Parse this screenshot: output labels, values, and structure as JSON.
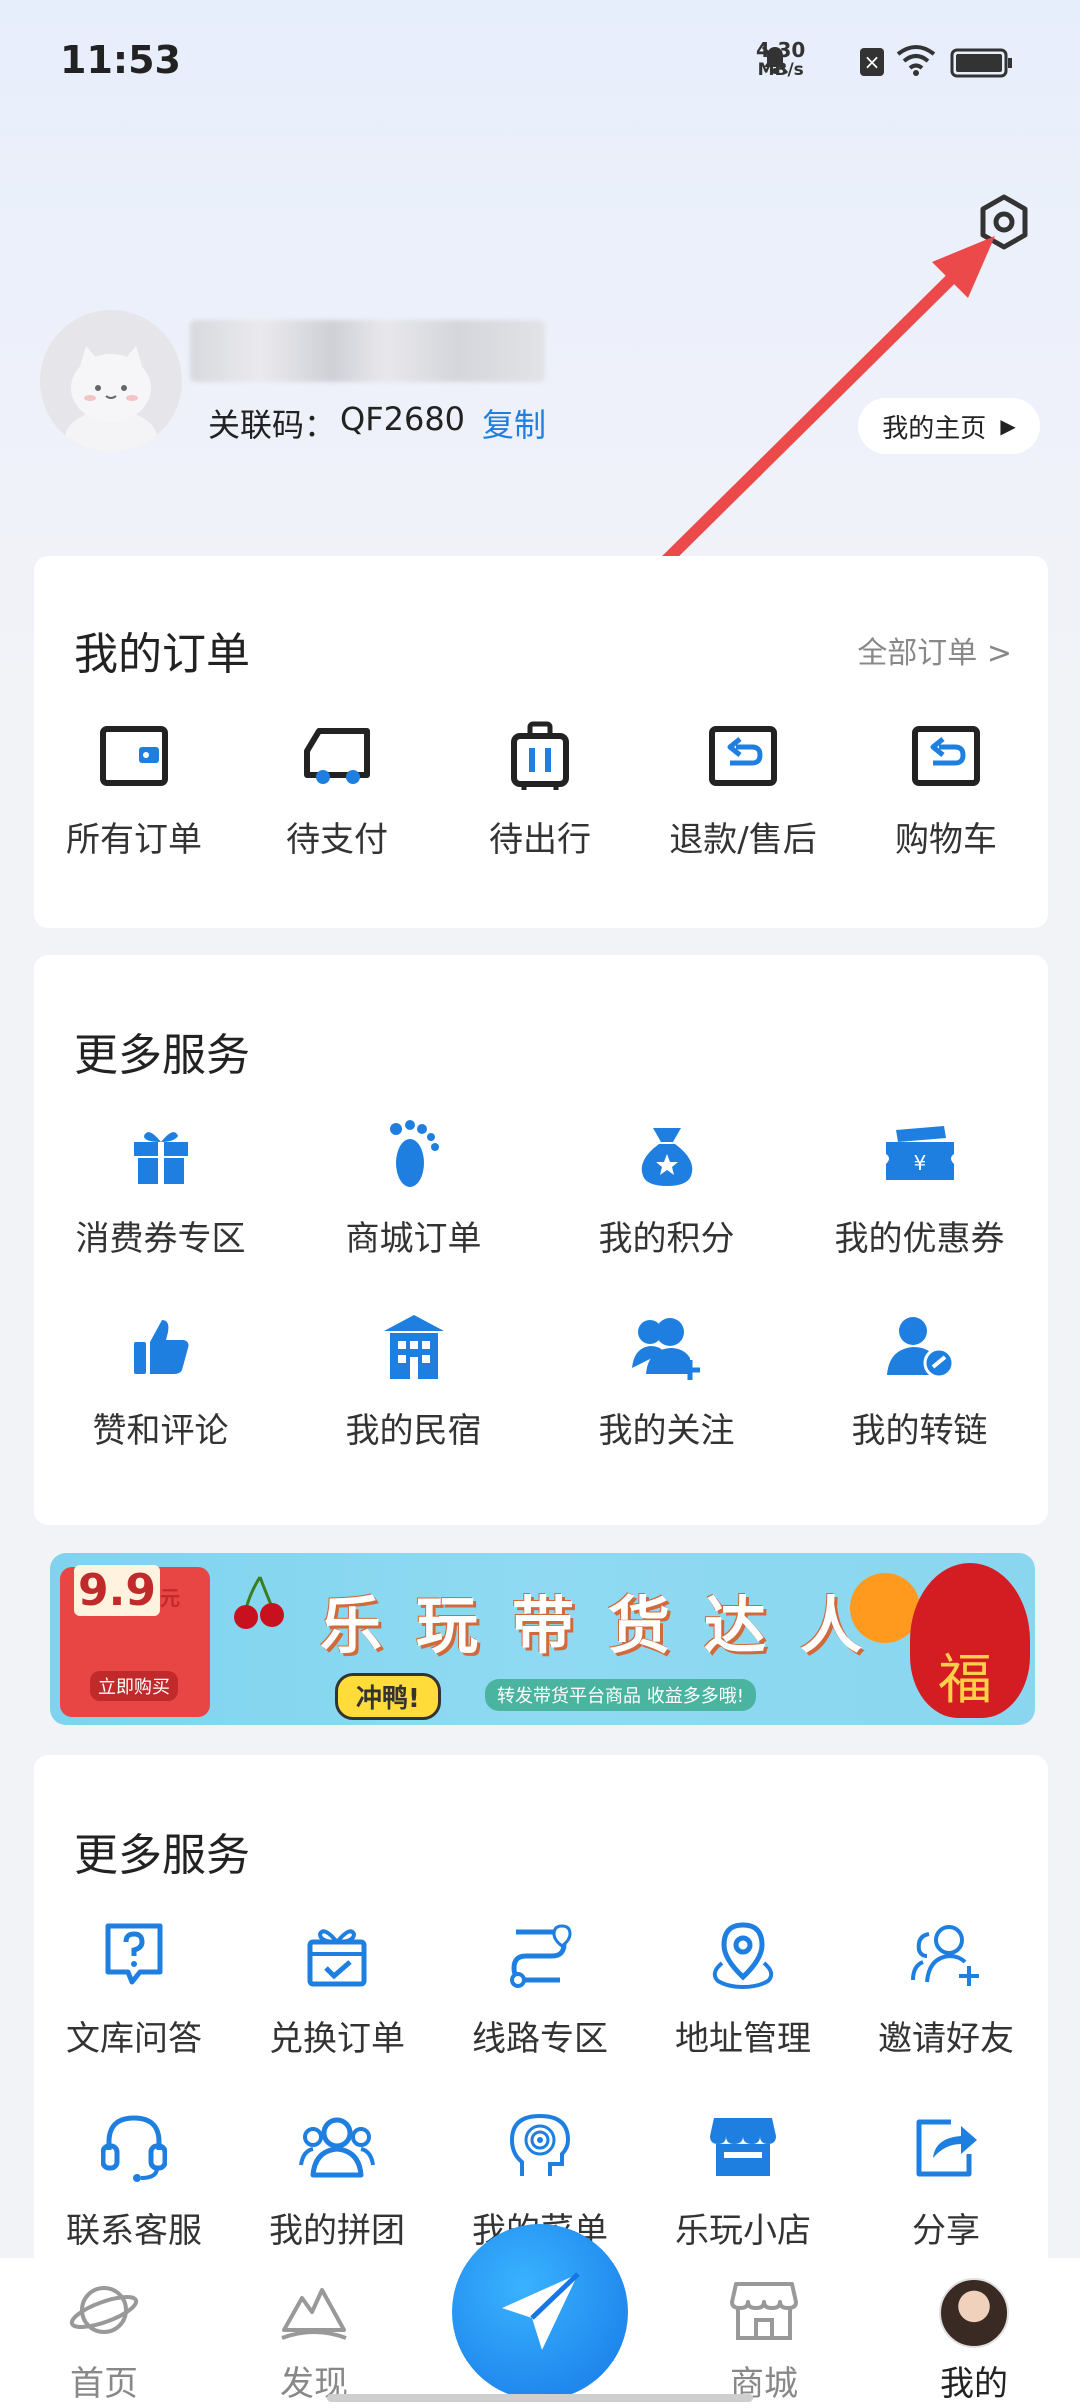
{
  "status_bar": {
    "time": "11:53",
    "net_speed": "4.30",
    "net_unit": "MB/s"
  },
  "profile": {
    "assoc_label": "关联码：",
    "assoc_code": "QF2680",
    "copy_label": "复制",
    "home_label": "我的主页"
  },
  "orders": {
    "title": "我的订单",
    "all_label": "全部订单 >",
    "items": [
      {
        "label": "所有订单",
        "icon": "wallet-icon"
      },
      {
        "label": "待支付",
        "icon": "truck-icon"
      },
      {
        "label": "待出行",
        "icon": "luggage-icon"
      },
      {
        "label": "退款/售后",
        "icon": "return-icon"
      },
      {
        "label": "购物车",
        "icon": "return-icon"
      }
    ]
  },
  "services1": {
    "title": "更多服务",
    "items": [
      {
        "label": "消费券专区",
        "icon": "gift-icon"
      },
      {
        "label": "商城订单",
        "icon": "footprint-icon"
      },
      {
        "label": "我的积分",
        "icon": "money-bag-icon"
      },
      {
        "label": "我的优惠券",
        "icon": "coupon-icon"
      },
      {
        "label": "赞和评论",
        "icon": "thumbs-up-icon"
      },
      {
        "label": "我的民宿",
        "icon": "house-icon"
      },
      {
        "label": "我的关注",
        "icon": "add-user-icon"
      },
      {
        "label": "我的转链",
        "icon": "user-link-icon"
      }
    ]
  },
  "banner": {
    "title": "乐玩带货达人",
    "price": "9.9",
    "price_unit": "元",
    "cta": "冲鸭!",
    "sub": "转发带货平台商品 收益多多哦!",
    "buy": "立即购买",
    "fu": "福"
  },
  "services2": {
    "title": "更多服务",
    "items": [
      {
        "label": "文库问答",
        "icon": "question-icon"
      },
      {
        "label": "兑换订单",
        "icon": "exchange-icon"
      },
      {
        "label": "线路专区",
        "icon": "route-icon"
      },
      {
        "label": "地址管理",
        "icon": "location-icon"
      },
      {
        "label": "邀请好友",
        "icon": "invite-icon"
      },
      {
        "label": "联系客服",
        "icon": "headset-icon"
      },
      {
        "label": "我的拼团",
        "icon": "group-icon"
      },
      {
        "label": "我的菜单",
        "icon": "ai-head-icon"
      },
      {
        "label": "乐玩小店",
        "icon": "shop-icon"
      },
      {
        "label": "分享",
        "icon": "share-icon"
      }
    ]
  },
  "nav": {
    "items": [
      {
        "label": "首页",
        "icon": "planet-icon"
      },
      {
        "label": "发现",
        "icon": "mountain-icon"
      },
      {
        "label": "商城",
        "icon": "store-icon"
      },
      {
        "label": "我的",
        "icon": "avatar-icon"
      }
    ]
  },
  "colors": {
    "accent": "#1f7fe0",
    "arrow": "#ec4a4a",
    "card": "#ffffff"
  }
}
